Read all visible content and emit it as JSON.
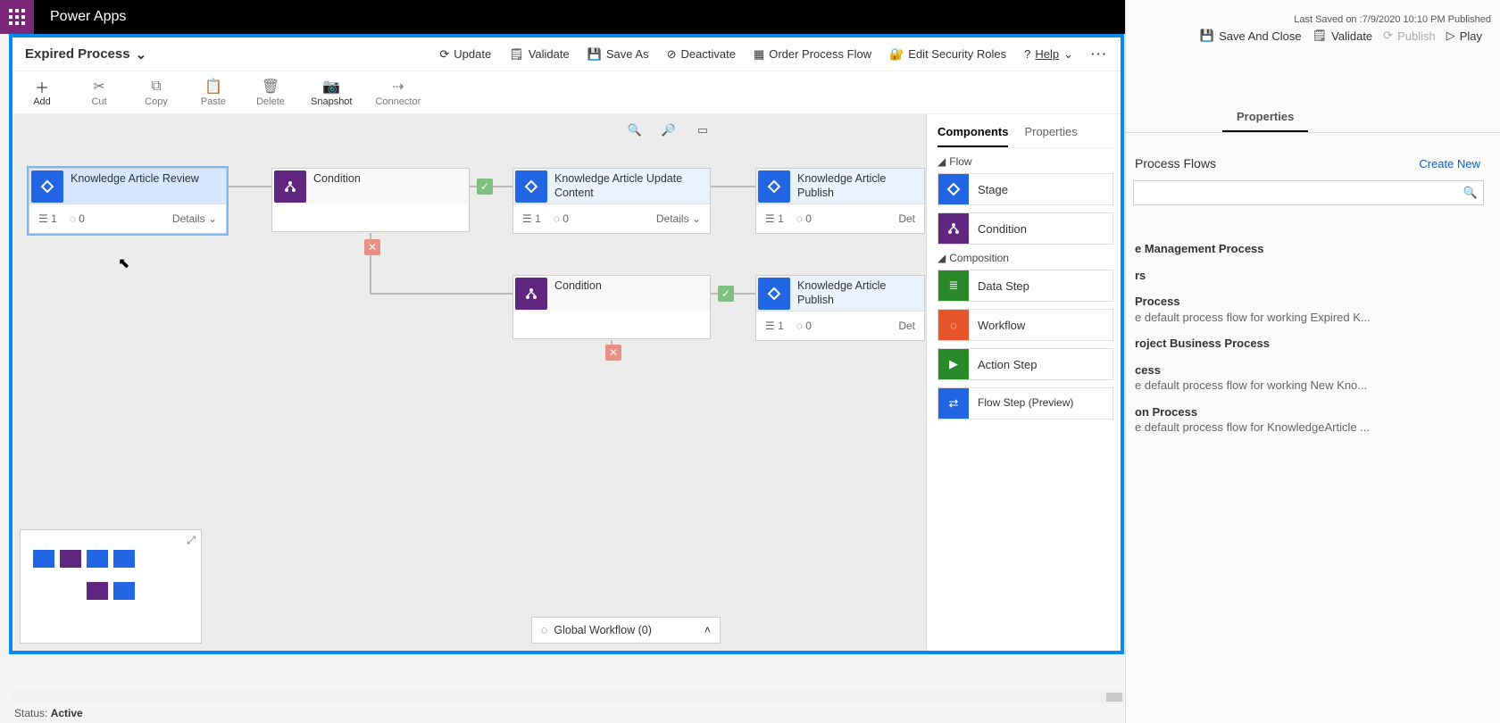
{
  "brand": "Power Apps",
  "rightpane": {
    "last_saved": "Last Saved on :7/9/2020 10:10 PM Published",
    "actions": {
      "save_close": "Save And Close",
      "validate": "Validate",
      "publish": "Publish",
      "play": "Play"
    },
    "tab_properties": "Properties",
    "list_title": "Process Flows",
    "create_new": "Create New",
    "items": [
      {
        "title": "e Management Process",
        "desc": ""
      },
      {
        "title": "rs",
        "desc": ""
      },
      {
        "title": "Process",
        "desc": "e default process flow for working Expired K..."
      },
      {
        "title": "roject Business Process",
        "desc": ""
      },
      {
        "title": "cess",
        "desc": "e default process flow for working New Kno..."
      },
      {
        "title": "on Process",
        "desc": "e default process flow for KnowledgeArticle ..."
      }
    ]
  },
  "designer": {
    "process_name": "Expired Process",
    "top_actions": {
      "update": "Update",
      "validate": "Validate",
      "save_as": "Save As",
      "deactivate": "Deactivate",
      "order": "Order Process Flow",
      "edit_security": "Edit Security Roles",
      "help": "Help"
    },
    "toolbar": {
      "add": "Add",
      "cut": "Cut",
      "copy": "Copy",
      "paste": "Paste",
      "delete": "Delete",
      "snapshot": "Snapshot",
      "connector": "Connector"
    },
    "side_panel": {
      "tab_components": "Components",
      "tab_properties": "Properties",
      "group_flow": "Flow",
      "group_composition": "Composition",
      "stage": "Stage",
      "condition": "Condition",
      "data_step": "Data Step",
      "workflow": "Workflow",
      "action_step": "Action Step",
      "flow_step": "Flow Step (Preview)"
    },
    "nodes": {
      "s1_title": "Knowledge Article Review",
      "s1_count": "1",
      "s1_flows": "0",
      "s1_details": "Details",
      "c1_title": "Condition",
      "s2_title": "Knowledge Article Update Content",
      "s2_count": "1",
      "s2_flows": "0",
      "s2_details": "Details",
      "s3_title": "Knowledge Article Publish",
      "s3_count": "1",
      "s3_flows": "0",
      "s3_details": "Det",
      "c2_title": "Condition",
      "s4_title": "Knowledge Article Publish",
      "s4_count": "1",
      "s4_flows": "0",
      "s4_details": "Det"
    },
    "global_workflow": "Global Workflow (0)"
  },
  "status": {
    "label": "Status:",
    "value": "Active"
  }
}
